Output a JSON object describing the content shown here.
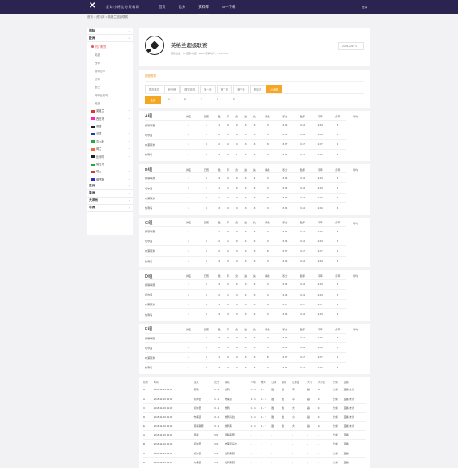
{
  "nav": {
    "site": "足球小将比分资料网",
    "menu": [
      "首页",
      "比分",
      "资料库",
      "APP下载"
    ],
    "active": 2,
    "login": "登录"
  },
  "breadcrumb": "首页 > 资料库 > 英格兰超级联赛",
  "sidebar": {
    "sections": [
      {
        "label": "国际",
        "arrow": ">"
      },
      {
        "label": "欧洲",
        "arrow": "∨"
      }
    ],
    "hot": "热门联赛",
    "sublinks": [
      "英超",
      "西甲",
      "德甲意甲",
      "法甲",
      "意乙",
      "荷甲比利时",
      "葡超"
    ],
    "countries": [
      "英格兰",
      "西班牙",
      "德国",
      "法国",
      "意大利",
      "荷兰",
      "比利时",
      "葡萄牙",
      "瑞士",
      "俄罗斯"
    ],
    "flagColors": [
      "#d33",
      "#f2b",
      "#222",
      "#23c",
      "#2a4",
      "#e63",
      "#222",
      "#2a3",
      "#d33",
      "#23c"
    ],
    "bottom": [
      "亚洲",
      "美洲",
      "大洋洲",
      "非洲"
    ],
    "expand": "+"
  },
  "league": {
    "name": "英格兰超级联赛",
    "meta": "赛队数量：20   国家/地区：ENG   赛季时间：8.10-05.21",
    "season": "2018-2019 ∨"
  },
  "panel": {
    "title": "赛程赛果",
    "tabs1": [
      "联赛排名",
      "积分榜",
      "联赛赛程",
      "第一轮",
      "第二轮",
      "第三轮",
      "附加赛",
      "小组赛"
    ],
    "tabs2": [
      "全部",
      "A",
      "B",
      "C",
      "D",
      "E"
    ]
  },
  "groupHeaders": [
    "排名",
    "已赛",
    "胜",
    "平",
    "负",
    "进",
    "失",
    "净胜",
    "积分",
    "胜率",
    "平率",
    "负率",
    "场均"
  ],
  "groups": [
    {
      "name": "A组",
      "rows": [
        [
          "曼联联赛",
          "1",
          "1",
          "1",
          "0",
          "0",
          "3",
          "3",
          "3",
          "3.34",
          "3.34",
          "2.34",
          "8"
        ],
        [
          "切尔西",
          "2",
          "1",
          "2",
          "1",
          "0",
          "3",
          "3",
          "3",
          "3.34",
          "3.34",
          "2.34",
          "6"
        ],
        [
          "布莱顿米",
          "3",
          "3",
          "2",
          "2",
          "3",
          "3",
          "3",
          "8",
          "3.37",
          "3.37",
          "2.27",
          "2"
        ],
        [
          "热刺马",
          "4",
          "3",
          "3",
          "3",
          "1",
          "3",
          "3",
          "3",
          "3.34",
          "3.34",
          "2.34",
          "3"
        ]
      ]
    },
    {
      "name": "B组",
      "rows": [
        [
          "曼联联赛",
          "1",
          "3",
          "3",
          "2",
          "0",
          "4",
          "4",
          "3",
          "3.34",
          "3.34",
          "2.34",
          "8"
        ],
        [
          "切尔西",
          "2",
          "1",
          "1",
          "1",
          "0",
          "4",
          "3",
          "3",
          "3.34",
          "3.34",
          "2.34",
          "6"
        ],
        [
          "布莱顿米",
          "3",
          "3",
          "1",
          "2",
          "3",
          "3",
          "3",
          "8",
          "3.37",
          "3.37",
          "2.27",
          "2"
        ],
        [
          "热刺马",
          "4",
          "3",
          "3",
          "3",
          "3",
          "3",
          "3",
          "3",
          "3.34",
          "3.34",
          "2.34",
          "3"
        ]
      ]
    },
    {
      "name": "C组",
      "rows": [
        [
          "曼联联赛",
          "1",
          "1",
          "1",
          "0",
          "0",
          "3",
          "3",
          "3",
          "3.34",
          "3.34",
          "2.34",
          "8"
        ],
        [
          "切尔西",
          "2",
          "3",
          "2",
          "1",
          "0",
          "4",
          "3",
          "3",
          "3.34",
          "3.34",
          "2.34",
          "6"
        ],
        [
          "布莱顿米",
          "3",
          "3",
          "2",
          "2",
          "3",
          "3",
          "3",
          "8",
          "3.37",
          "3.37",
          "2.27",
          "2"
        ],
        [
          "热刺马",
          "4",
          "3",
          "3",
          "3",
          "3",
          "3",
          "3",
          "3",
          "3.34",
          "3.34",
          "2.34",
          "3"
        ]
      ]
    },
    {
      "name": "D组",
      "rows": [
        [
          "曼联联赛",
          "1",
          "3",
          "3",
          "2",
          "0",
          "3",
          "3",
          "3",
          "3.34",
          "3.34",
          "2.34",
          "8"
        ],
        [
          "切尔西",
          "2",
          "3",
          "2",
          "1",
          "3",
          "4",
          "3",
          "3",
          "3.34",
          "3.34",
          "2.34",
          "6"
        ],
        [
          "布莱顿米",
          "3",
          "3",
          "1",
          "3",
          "3",
          "3",
          "3",
          "8",
          "3.37",
          "3.37",
          "2.27",
          "2"
        ],
        [
          "热刺马",
          "4",
          "3",
          "3",
          "3",
          "3",
          "3",
          "3",
          "3",
          "3.34",
          "3.34",
          "2.34",
          "3"
        ]
      ]
    },
    {
      "name": "E组",
      "rows": [
        [
          "曼联联赛",
          "1",
          "3",
          "3",
          "0",
          "0",
          "3",
          "3",
          "3",
          "3.34",
          "3.34",
          "2.34",
          "8"
        ],
        [
          "切尔西",
          "2",
          "3",
          "3",
          "1",
          "0",
          "4",
          "3",
          "3",
          "3.34",
          "3.34",
          "2.34",
          "6"
        ],
        [
          "布莱顿米",
          "3",
          "3",
          "1",
          "2",
          "3",
          "3",
          "3",
          "8",
          "3.37",
          "3.37",
          "2.27",
          "2"
        ],
        [
          "热刺马",
          "4",
          "3",
          "3",
          "3",
          "3",
          "3",
          "3",
          "3",
          "3.34",
          "3.34",
          "2.34",
          "3"
        ]
      ]
    }
  ],
  "matchHeaders": [
    "轮次",
    "时间",
    "主队",
    "比分",
    "客队",
    "半场",
    "角球",
    "让球",
    "进球",
    "让球盘",
    "大小",
    "大小盘",
    "分析",
    "直播"
  ],
  "matches": [
    [
      "A",
      "2018-11-29 19:30",
      "曼联",
      "3 - 1",
      "热刺",
      "0 - 1",
      "2 - 7",
      "胜",
      "胜",
      "平",
      "赢",
      "12",
      "分析",
      "直播 统计"
    ],
    [
      "A",
      "2018-11-29 19:30",
      "切尔西",
      "1 - 0",
      "布莱顿",
      "1 - 1",
      "0 - 5",
      "胜",
      "胜",
      "平",
      "赢",
      "13",
      "分析",
      "直播 统计"
    ],
    [
      "C",
      "2018-11-29 19:30",
      "切尔西",
      "3 - 1",
      "热刺",
      "0 - 1",
      "2 - 7",
      "胜",
      "胜",
      "大",
      "赢",
      "9",
      "分析",
      "直播 统计"
    ],
    [
      "D",
      "2018-11-29 19:30",
      "布莱顿",
      "3 - 1",
      "热刺马拉",
      "0 - 1",
      "2 - 7",
      "胜",
      "胜",
      "小",
      "赢",
      "9",
      "分析",
      "直播 统计"
    ],
    [
      "E",
      "2018-11-29 19:30",
      "曼联联赛",
      "3 - 1",
      "热刺联",
      "0 - 1",
      "2 - 7",
      "胜",
      "胜",
      "大",
      "赢",
      "12",
      "分析",
      "直播 统计"
    ],
    [
      "A",
      "2018-11-29 19:30",
      "曼联",
      "VS",
      "曼联联赛",
      "-",
      "-",
      "-",
      "-",
      "-",
      "-",
      "-",
      "分析",
      "直播"
    ],
    [
      "B",
      "2018-11-29 19:30",
      "切尔西",
      "VS",
      "布莱顿马拉",
      "-",
      "-",
      "-",
      "-",
      "-",
      "-",
      "-",
      "分析",
      "直播"
    ],
    [
      "C",
      "2018-11-29 19:30",
      "切尔西",
      "VS",
      "热刺联赛",
      "-",
      "-",
      "-",
      "-",
      "-",
      "-",
      "-",
      "分析",
      "直播"
    ],
    [
      "D",
      "2018-11-29 19:30",
      "布莱顿",
      "VS",
      "热刺联赛",
      "-",
      "-",
      "-",
      "-",
      "-",
      "-",
      "-",
      "分析",
      "直播"
    ]
  ]
}
